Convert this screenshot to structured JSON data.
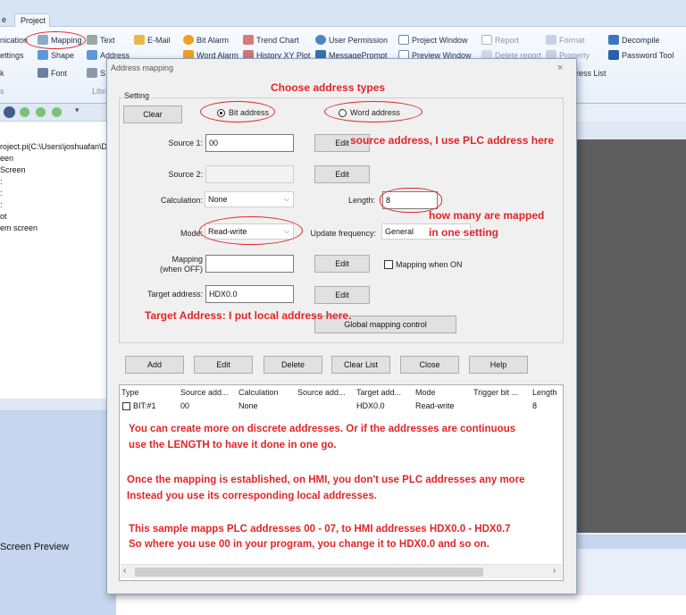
{
  "ribbon": {
    "tabs": [
      "e",
      "Project"
    ],
    "items": {
      "communication": "nication",
      "mapping": "Mapping",
      "text": "Text",
      "email": "E-Mail",
      "bit_alarm": "Bit Alarm",
      "trend_chart": "Trend Chart",
      "user_permission": "User Permission",
      "project_window": "Project Window",
      "report": "Report",
      "format": "Format",
      "decompile": "Decompile",
      "settings": "ettings",
      "shape": "Shape",
      "address": "Address",
      "word_alarm": "Word Alarm",
      "history_xy_plot": "History XY Plot",
      "message_prompt": "MessagePrompt",
      "preview_window": "Preview Window",
      "delete_report": "Delete report",
      "property": "Property",
      "password_tool": "Password Tool",
      "k": "k",
      "font": "Font",
      "s": "S",
      "ress_list": "ress List"
    },
    "groups": {
      "g1": "s",
      "g2": "Libra"
    }
  },
  "left_panel": {
    "tree": [
      "roject.pi(C:\\Users\\joshuafan\\D",
      "een",
      "Screen",
      ":",
      ":",
      ":",
      "ot",
      "em screen"
    ],
    "screen_preview": "Screen Preview"
  },
  "dialog": {
    "title": "Address mapping",
    "close": "×",
    "setting_label": "Setting",
    "clear": "Clear",
    "bit_address": "Bit address",
    "word_address": "Word address",
    "source1_label": "Source 1:",
    "source1_value": "00",
    "source2_label": "Source 2:",
    "source2_value": "",
    "edit": "Edit",
    "calculation_label": "Calculation:",
    "calculation_value": "None",
    "length_label": "Length:",
    "length_value": "8",
    "mode_label": "Mode:",
    "mode_value": "Read-write",
    "update_label": "Update frequency:",
    "update_value": "General",
    "mapping_label_1": "Mapping",
    "mapping_label_2": "(when OFF)",
    "mapping_value": "",
    "mapping_when_on": "Mapping when ON",
    "target_label": "Target address:",
    "target_value": "HDX0.0",
    "global_mapping": "Global mapping control",
    "buttons": {
      "add": "Add",
      "edit": "Edit",
      "delete": "Delete",
      "clear_list": "Clear List",
      "close": "Close",
      "help": "Help"
    },
    "table": {
      "headers": [
        "Type",
        "Source add...",
        "Calculation",
        "Source add...",
        "Target add...",
        "Mode",
        "Trigger bit ...",
        "Length"
      ],
      "rows": [
        [
          "BIT:#1",
          "00",
          "None",
          "",
          "HDX0.0",
          "Read-write",
          "",
          "8"
        ]
      ]
    }
  },
  "annotations": {
    "choose": "Choose address types",
    "source": "source address, I use PLC address here",
    "how_many_1": "how many are mapped",
    "how_many_2": "in one setting",
    "target": "Target Address: I put local address here.",
    "note1_l1": "You can create more on discrete addresses. Or if the addresses are continuous",
    "note1_l2": "use the LENGTH to have it done in one go.",
    "note2_l1": "Once the mapping is established, on HMI, you don't use PLC addresses any more",
    "note2_l2": "Instead you use its corresponding local addresses.",
    "note3_l1": "This sample mapps PLC addresses 00 - 07, to HMI addresses HDX0.0 - HDX0.7",
    "note3_l2": "So where you use 00 in your program, you change it to HDX0.0 and so on."
  },
  "colors": {
    "annotation": "#e0262a",
    "ribbon_bg": "#e8f0fa",
    "canvas": "#5e5e5e"
  }
}
